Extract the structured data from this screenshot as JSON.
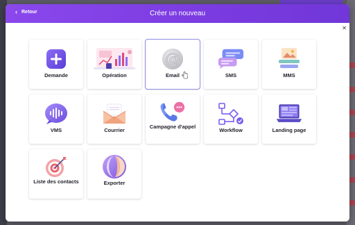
{
  "modal": {
    "title": "Créer un nouveau",
    "back_label": "Retour"
  },
  "cards": [
    {
      "label": "Demande",
      "icon": "plus-icon",
      "selected": false
    },
    {
      "label": "Opération",
      "icon": "analytics-icon",
      "selected": false
    },
    {
      "label": "Email",
      "icon": "at-sign-icon",
      "selected": true
    },
    {
      "label": "SMS",
      "icon": "chat-bubbles-icon",
      "selected": false
    },
    {
      "label": "MMS",
      "icon": "image-message-icon",
      "selected": false
    },
    {
      "label": "VMS",
      "icon": "voice-message-icon",
      "selected": false
    },
    {
      "label": "Courrier",
      "icon": "envelope-icon",
      "selected": false
    },
    {
      "label": "Campagne d'appel",
      "icon": "phone-call-icon",
      "selected": false
    },
    {
      "label": "Workflow",
      "icon": "workflow-icon",
      "selected": false
    },
    {
      "label": "Landing page",
      "icon": "laptop-icon",
      "selected": false
    },
    {
      "label": "Liste des contacts",
      "icon": "target-icon",
      "selected": false
    },
    {
      "label": "Exporter",
      "icon": "export-icon",
      "selected": false
    }
  ],
  "colors": {
    "header_gradient_start": "#8a48ec",
    "header_gradient_end": "#7137d8",
    "accent": "#7b5cf0",
    "selected_border": "#8f8de6"
  }
}
